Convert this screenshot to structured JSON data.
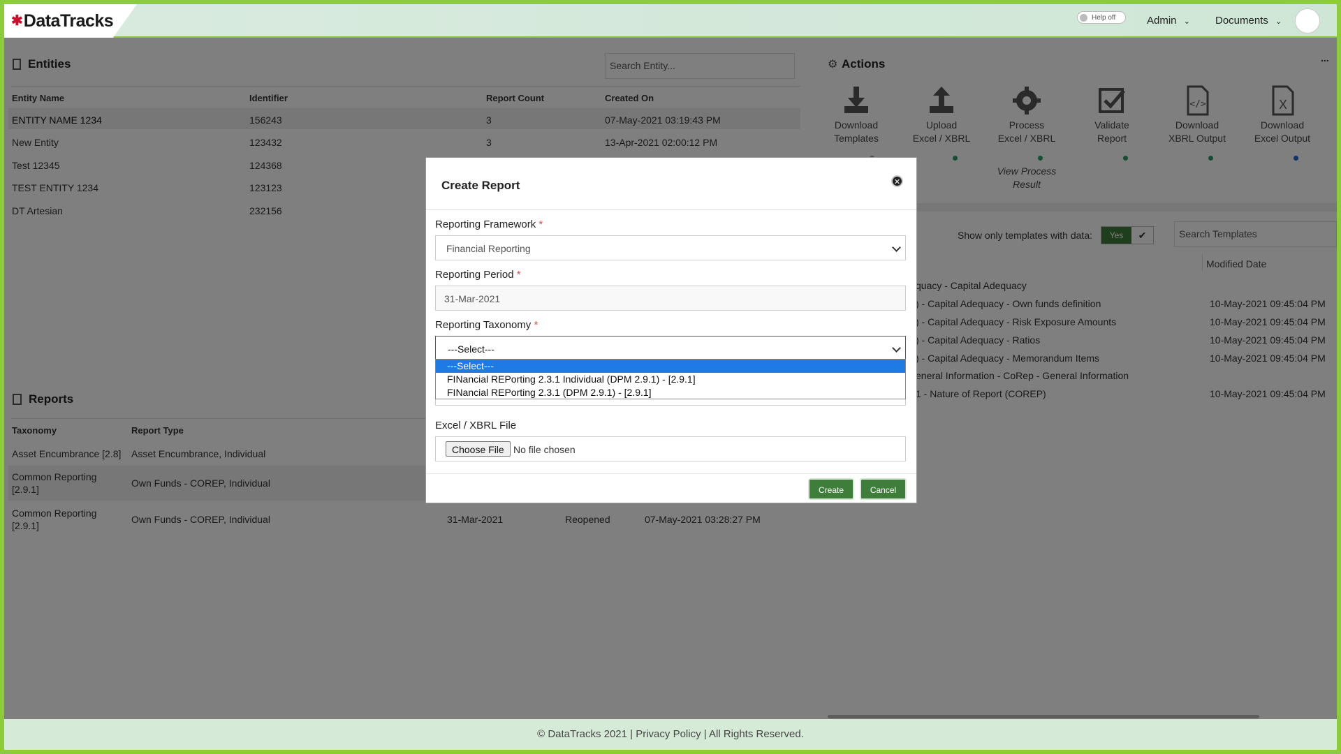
{
  "header": {
    "logo": "DataTracks",
    "help_toggle": "Help off",
    "nav": {
      "admin": "Admin",
      "documents": "Documents"
    }
  },
  "entities": {
    "title": "Entities",
    "search_placeholder": "Search Entity...",
    "columns": [
      "Entity Name",
      "Identifier",
      "Report Count",
      "Created On"
    ],
    "rows": [
      {
        "name": "ENTITY NAME 1234",
        "identifier": "156243",
        "count": "3",
        "created": "07-May-2021 03:19:43 PM"
      },
      {
        "name": "New Entity",
        "identifier": "123432",
        "count": "3",
        "created": "13-Apr-2021 02:00:12 PM"
      },
      {
        "name": "Test 12345",
        "identifier": "124368",
        "count": "",
        "created": ""
      },
      {
        "name": "TEST ENTITY 1234",
        "identifier": "123123",
        "count": "",
        "created": ""
      },
      {
        "name": "DT Artesian",
        "identifier": "232156",
        "count": "",
        "created": ""
      }
    ]
  },
  "reports": {
    "title": "Reports",
    "columns": [
      "Taxonomy",
      "Report Type"
    ],
    "rows": [
      {
        "taxonomy": "Asset Encumbrance [2.8]",
        "taxonomy2": "",
        "type": "Asset Encumbrance, Individual",
        "period": "",
        "status": "",
        "created": ""
      },
      {
        "taxonomy": "Common Reporting",
        "taxonomy2": "[2.9.1]",
        "type": "Own Funds - COREP, Individual",
        "period": "",
        "status": "",
        "created": ""
      },
      {
        "taxonomy": "Common Reporting",
        "taxonomy2": "[2.9.1]",
        "type": "Own Funds - COREP, Individual",
        "period": "31-Mar-2021",
        "status": "Reopened",
        "created": "07-May-2021 03:28:27 PM"
      }
    ]
  },
  "actions": {
    "title": "Actions",
    "more": "...",
    "items": [
      {
        "line1": "Download",
        "line2": "Templates",
        "icon": "download-icon"
      },
      {
        "line1": "Upload",
        "line2": "Excel / XBRL",
        "icon": "upload-icon"
      },
      {
        "line1": "Process",
        "line2": "Excel / XBRL",
        "icon": "gear-icon"
      },
      {
        "line1": "Validate",
        "line2": "Report",
        "icon": "checkbox-icon"
      },
      {
        "line1": "Download",
        "line2": "XBRL Output",
        "icon": "code-file-icon"
      },
      {
        "line1": "Download",
        "line2": "Excel Output",
        "icon": "excel-file-icon"
      }
    ],
    "view_process_1": "View Process",
    "view_process_2": "Result"
  },
  "templates": {
    "filter_label": "Show only templates with data:",
    "toggle_yes": "Yes",
    "search_placeholder": "Search Templates",
    "col_modified": "Modified Date",
    "rows": [
      {
        "name": "quacy - Capital Adequacy",
        "date": ""
      },
      {
        "name": ") - Capital Adequacy - Own funds definition",
        "date": "10-May-2021 09:45:04 PM"
      },
      {
        "name": ") - Capital Adequacy - Risk Exposure Amounts",
        "date": "10-May-2021 09:45:04 PM"
      },
      {
        "name": ") - Capital Adequacy - Ratios",
        "date": "10-May-2021 09:45:04 PM"
      },
      {
        "name": ") - Capital Adequacy - Memorandum Items",
        "date": "10-May-2021 09:45:04 PM"
      },
      {
        "name": "eneral Information - CoRep - General Information",
        "date": ""
      },
      {
        "name": "1 - Nature of Report (COREP)",
        "date": "10-May-2021 09:45:04 PM"
      }
    ]
  },
  "modal": {
    "title": "Create Report",
    "framework_label": "Reporting Framework",
    "framework_value": "Financial Reporting",
    "period_label": "Reporting Period",
    "period_value": "31-Mar-2021",
    "taxonomy_label": "Reporting Taxonomy",
    "taxonomy_value": "---Select---",
    "taxonomy_options": [
      "---Select---",
      "FINancial REPorting 2.3.1 Individual (DPM 2.9.1) - [2.9.1]",
      "FINancial REPorting 2.3.1 (DPM 2.9.1) - [2.9.1]"
    ],
    "file_label": "Excel / XBRL File",
    "file_button": "Choose File",
    "file_status": "No file chosen",
    "create": "Create",
    "cancel": "Cancel",
    "required_mark": "*"
  },
  "footer": "© DataTracks 2021 | Privacy Policy | All Rights Reserved.",
  "colors": {
    "accent": "#8ccc3a",
    "button": "#3f7d3a",
    "select_highlight": "#1e7be6"
  }
}
